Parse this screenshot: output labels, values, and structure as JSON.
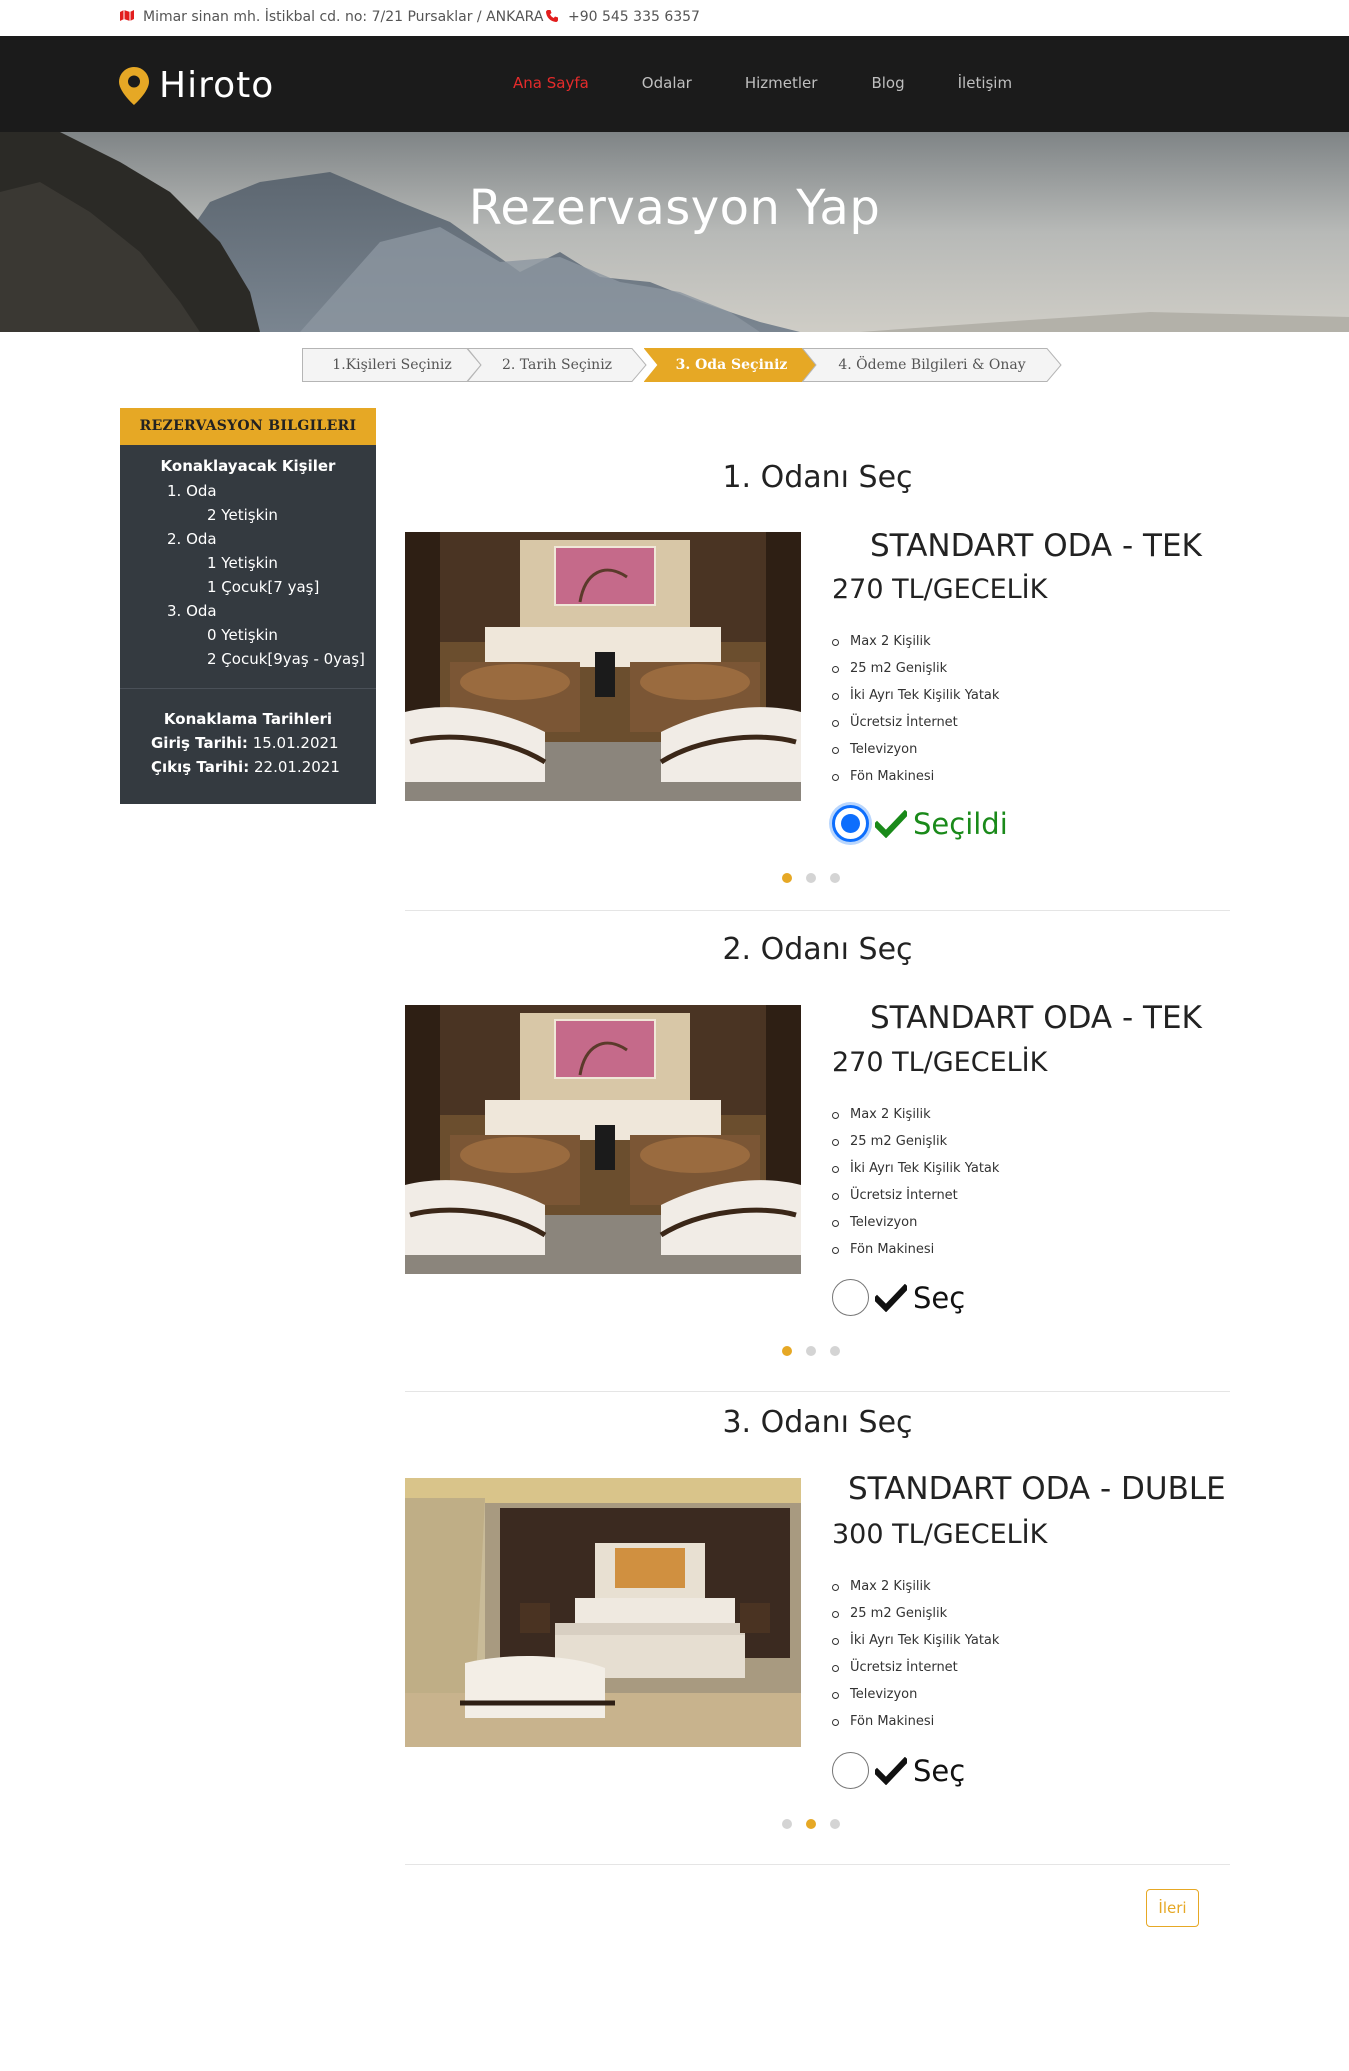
{
  "topbar": {
    "address": "Mimar sinan mh. İstikbal cd. no: 7/21 Pursaklar / ANKARA",
    "phone": "+90 545 335 6357",
    "map_icon": "map-icon",
    "phone_icon": "phone-icon"
  },
  "header": {
    "logo": "Hiroto",
    "logo_icon": "location-pin-icon",
    "nav": [
      {
        "label": "Ana Sayfa",
        "active": true
      },
      {
        "label": "Odalar",
        "active": false
      },
      {
        "label": "Hizmetler",
        "active": false
      },
      {
        "label": "Blog",
        "active": false
      },
      {
        "label": "İletişim",
        "active": false
      }
    ]
  },
  "hero": {
    "title": "Rezervasyon Yap"
  },
  "steps": [
    {
      "label": "1.Kişileri Seçiniz",
      "active": false
    },
    {
      "label": "2. Tarih Seçiniz",
      "active": false
    },
    {
      "label": "3. Oda Seçiniz",
      "active": true
    },
    {
      "label": "4. Ödeme Bilgileri & Onay",
      "active": false
    }
  ],
  "sidebar": {
    "header": "REZERVASYON BILGILERI",
    "guests_title": "Konaklayacak Kişiler",
    "rooms": [
      {
        "name": "1. Oda",
        "lines": [
          "2 Yetişkin"
        ]
      },
      {
        "name": "2. Oda",
        "lines": [
          "1 Yetişkin",
          "1 Çocuk[7 yaş]"
        ]
      },
      {
        "name": "3. Oda",
        "lines": [
          "0 Yetişkin",
          "2 Çocuk[9yaş - 0yaş]"
        ]
      }
    ],
    "dates_title": "Konaklama Tarihleri",
    "checkin_label": "Giriş Tarihi:",
    "checkin_value": "15.01.2021",
    "checkout_label": "Çıkış Tarihi:",
    "checkout_value": "22.01.2021"
  },
  "room_sections": [
    {
      "title": "1. Odanı Seç",
      "room_name": "STANDART ODA - TEK",
      "price": "270 TL/GECELİK",
      "features": [
        "Max 2 Kişilik",
        "25 m2 Genişlik",
        "İki Ayrı Tek Kişilik Yatak",
        "Ücretsiz İnternet",
        "Televizyon",
        "Fön Makinesi"
      ],
      "selected": true,
      "select_label": "Seçildi",
      "active_dot": 0
    },
    {
      "title": "2. Odanı Seç",
      "room_name": "STANDART ODA - TEK",
      "price": "270 TL/GECELİK",
      "features": [
        "Max 2 Kişilik",
        "25 m2 Genişlik",
        "İki Ayrı Tek Kişilik Yatak",
        "Ücretsiz İnternet",
        "Televizyon",
        "Fön Makinesi"
      ],
      "selected": false,
      "select_label": "Seç",
      "active_dot": 0
    },
    {
      "title": "3. Odanı Seç",
      "room_name": "STANDART ODA - DUBLE",
      "price": "300 TL/GECELİK",
      "features": [
        "Max 2 Kişilik",
        "25 m2 Genişlik",
        "İki Ayrı Tek Kişilik Yatak",
        "Ücretsiz İnternet",
        "Televizyon",
        "Fön Makinesi"
      ],
      "selected": false,
      "select_label": "Seç",
      "active_dot": 1
    }
  ],
  "next_button": "İleri",
  "colors": {
    "accent": "#e6a825",
    "nav_active": "#e52b2b",
    "header_bg": "#1b1b1b",
    "sidebar_bg": "#343a40",
    "selected_green": "#1a8a1a",
    "radio_blue": "#0d6efd"
  }
}
